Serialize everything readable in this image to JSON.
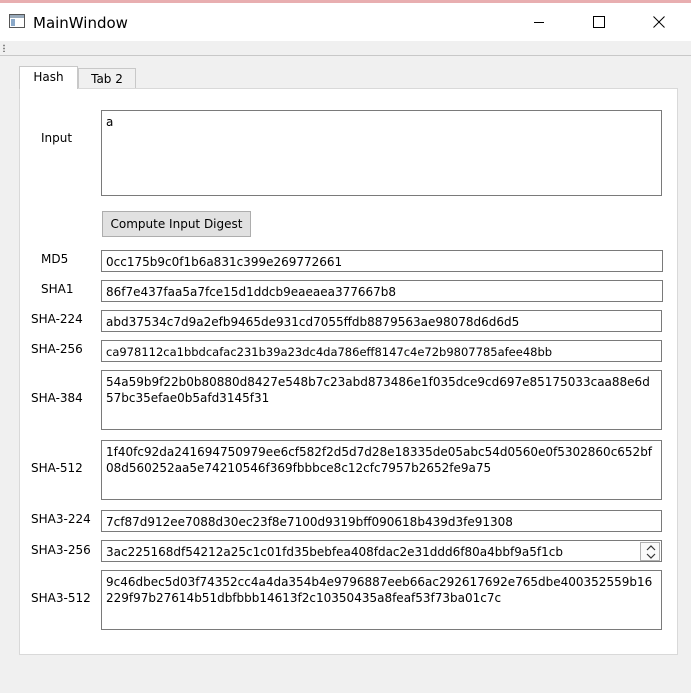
{
  "window": {
    "title": "MainWindow",
    "title_color": "#000000"
  },
  "tabs": [
    {
      "label": "Hash",
      "selected": true
    },
    {
      "label": "Tab 2",
      "selected": false
    }
  ],
  "input": {
    "label": "Input",
    "value": "a"
  },
  "compute_button": {
    "label": "Compute Input Digest"
  },
  "hashes": {
    "md5": {
      "label": "MD5",
      "value": "0cc175b9c0f1b6a831c399e269772661"
    },
    "sha1": {
      "label": "SHA1",
      "value": "86f7e437faa5a7fce15d1ddcb9eaeaea377667b8"
    },
    "sha224": {
      "label": "SHA-224",
      "value": "abd37534c7d9a2efb9465de931cd7055ffdb8879563ae98078d6d6d5"
    },
    "sha256": {
      "label": "SHA-256",
      "value": "ca978112ca1bbdcafac231b39a23dc4da786eff8147c4e72b9807785afee48bb"
    },
    "sha384": {
      "label": "SHA-384",
      "value": "54a59b9f22b0b80880d8427e548b7c23abd873486e1f035dce9cd697e85175033caa88e6d57bc35efae0b5afd3145f31"
    },
    "sha512": {
      "label": "SHA-512",
      "value": "1f40fc92da241694750979ee6cf582f2d5d7d28e18335de05abc54d0560e0f5302860c652bf08d560252aa5e74210546f369fbbbce8c12cfc7957b2652fe9a75"
    },
    "sha3_224": {
      "label": "SHA3-224",
      "value": "7cf87d912ee7088d30ec23f8e7100d9319bff090618b439d3fe91308"
    },
    "sha3_256": {
      "label": "SHA3-256",
      "value": "3ac225168df54212a25c1c01fd35bebfea408fdac2e31ddd6f80a4bbf9a5f1cb"
    },
    "sha3_512": {
      "label": "SHA3-512",
      "value": "9c46dbec5d03f74352cc4a4da354b4e9796887eeb66ac292617692e765dbe400352559b16229f97b27614b51dbfbbb14613f2c10350435a8feaf53f73ba01c7c"
    }
  },
  "icons": {
    "app": "app-window-icon",
    "minimize": "minimize-icon",
    "maximize": "maximize-icon",
    "close": "close-icon",
    "spin_up": "spin-up-icon",
    "spin_down": "spin-down-icon"
  }
}
